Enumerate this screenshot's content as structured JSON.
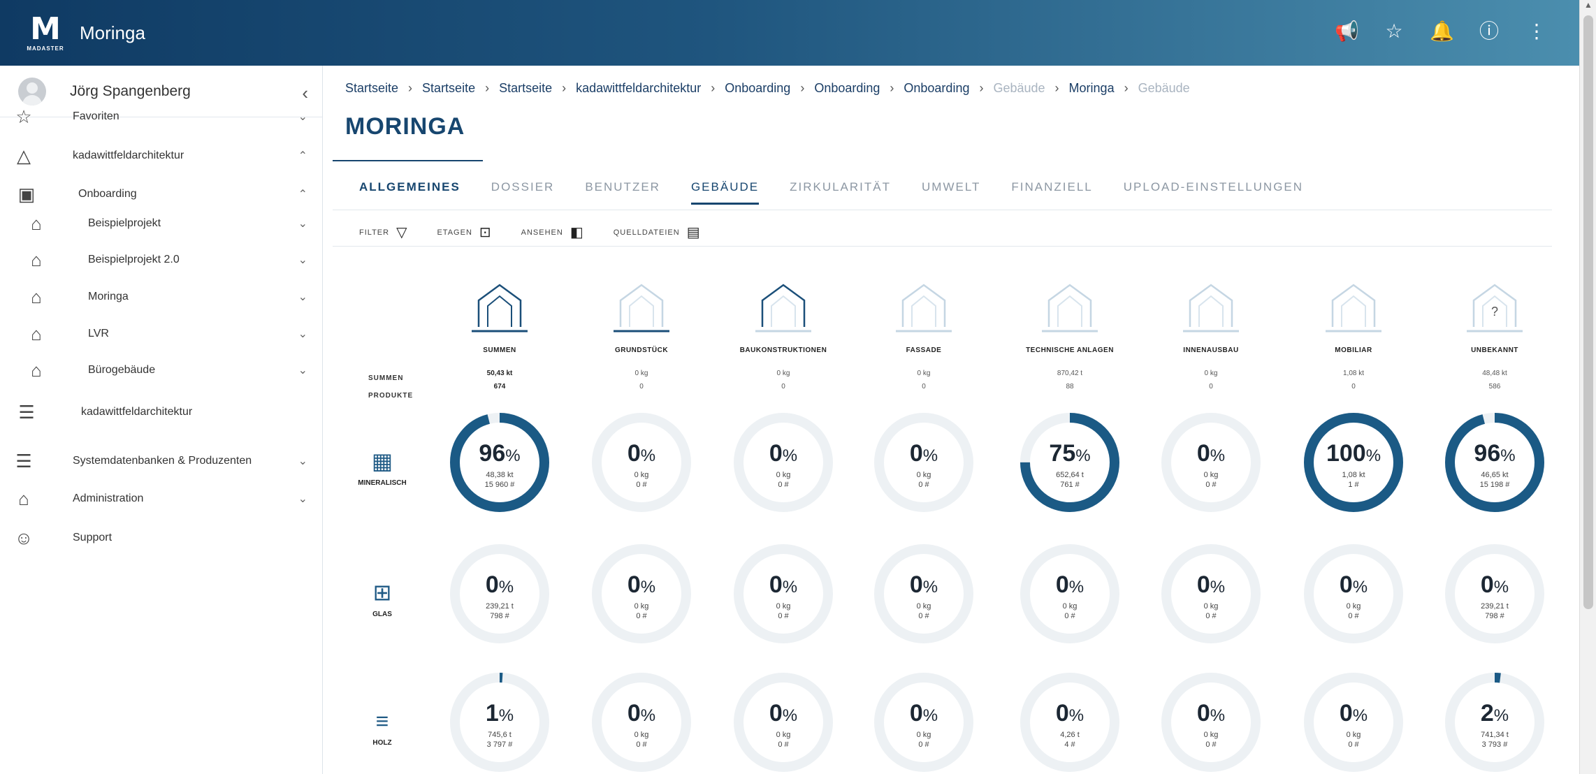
{
  "header": {
    "app_title": "Moringa",
    "logo_text": "MADASTER",
    "icons": [
      "megaphone-icon",
      "star-icon",
      "bell-icon",
      "info-icon",
      "more-icon"
    ]
  },
  "sidebar": {
    "user_name": "Jörg Spangenberg",
    "items": [
      {
        "label": "Favoriten",
        "icon": "star-outline-icon",
        "chev": "⌄"
      },
      {
        "label": "kadawittfeldarchitektur",
        "icon": "triangle-icon",
        "chev": "⌃"
      },
      {
        "label": "Onboarding",
        "icon": "folder-icon",
        "chev": "⌃"
      },
      {
        "label": "Beispielprojekt",
        "icon": "building-icon",
        "chev": "⌄"
      },
      {
        "label": "Beispielprojekt 2.0",
        "icon": "building-icon",
        "chev": "⌄"
      },
      {
        "label": "Moringa",
        "icon": "building-icon",
        "chev": "⌄"
      },
      {
        "label": "LVR",
        "icon": "building-icon",
        "chev": "⌄"
      },
      {
        "label": "Bürogebäude",
        "icon": "building-icon",
        "chev": "⌄"
      },
      {
        "label": "kadawittfeldarchitektur",
        "icon": "database-icon",
        "chev": ""
      },
      {
        "label": "Systemdatenbanken & Produzenten",
        "icon": "database-settings-icon",
        "chev": "⌄"
      },
      {
        "label": "Administration",
        "icon": "admin-house-icon",
        "chev": "⌄"
      },
      {
        "label": "Support",
        "icon": "support-icon",
        "chev": ""
      }
    ]
  },
  "breadcrumb": [
    {
      "label": "Startseite",
      "dim": false
    },
    {
      "label": "Startseite",
      "dim": false
    },
    {
      "label": "Startseite",
      "dim": false
    },
    {
      "label": "kadawittfeldarchitektur",
      "dim": false
    },
    {
      "label": "Onboarding",
      "dim": false
    },
    {
      "label": "Onboarding",
      "dim": false
    },
    {
      "label": "Onboarding",
      "dim": false
    },
    {
      "label": "Gebäude",
      "dim": true
    },
    {
      "label": "Moringa",
      "dim": false
    },
    {
      "label": "Gebäude",
      "dim": true
    }
  ],
  "page_title": "MORINGA",
  "tabs": [
    "ALLGEMEINES",
    "DOSSIER",
    "BENUTZER",
    "GEBÄUDE",
    "ZIRKULARITÄT",
    "UMWELT",
    "FINANZIELL",
    "UPLOAD-EINSTELLUNGEN"
  ],
  "active_tab": "GEBÄUDE",
  "toolbar": [
    {
      "label": "FILTER",
      "icon": "filter-icon"
    },
    {
      "label": "ETAGEN",
      "icon": "floors-icon"
    },
    {
      "label": "ANSEHEN",
      "icon": "view-icon"
    },
    {
      "label": "QUELLDATEIEN",
      "icon": "source-file-icon"
    }
  ],
  "row_labels": {
    "summen": "SUMMEN",
    "produkte": "PRODUKTE"
  },
  "categories": [
    {
      "name": "SUMMEN",
      "sum": "50,43 kt",
      "products": "674"
    },
    {
      "name": "GRUNDSTÜCK",
      "sum": "0 kg",
      "products": "0"
    },
    {
      "name": "BAUKONSTRUKTIONEN",
      "sum": "0 kg",
      "products": "0"
    },
    {
      "name": "FASSADE",
      "sum": "0 kg",
      "products": "0"
    },
    {
      "name": "TECHNISCHE ANLAGEN",
      "sum": "870,42 t",
      "products": "88"
    },
    {
      "name": "INNENAUSBAU",
      "sum": "0 kg",
      "products": "0"
    },
    {
      "name": "MOBILIAR",
      "sum": "1,08 kt",
      "products": "0"
    },
    {
      "name": "UNBEKANNT",
      "sum": "48,48 kt",
      "products": "586"
    }
  ],
  "materials": [
    {
      "name": "MINERALISCH",
      "icon": "mineral-icon",
      "cells": [
        {
          "pct": 96,
          "weight": "48,38 kt",
          "count": "15 960 #"
        },
        {
          "pct": 0,
          "weight": "0 kg",
          "count": "0 #"
        },
        {
          "pct": 0,
          "weight": "0 kg",
          "count": "0 #"
        },
        {
          "pct": 0,
          "weight": "0 kg",
          "count": "0 #"
        },
        {
          "pct": 75,
          "weight": "652,64 t",
          "count": "761 #"
        },
        {
          "pct": 0,
          "weight": "0 kg",
          "count": "0 #"
        },
        {
          "pct": 100,
          "weight": "1,08 kt",
          "count": "1 #"
        },
        {
          "pct": 96,
          "weight": "46,65 kt",
          "count": "15 198 #"
        }
      ]
    },
    {
      "name": "GLAS",
      "icon": "window-icon",
      "cells": [
        {
          "pct": 0,
          "weight": "239,21 t",
          "count": "798 #"
        },
        {
          "pct": 0,
          "weight": "0 kg",
          "count": "0 #"
        },
        {
          "pct": 0,
          "weight": "0 kg",
          "count": "0 #"
        },
        {
          "pct": 0,
          "weight": "0 kg",
          "count": "0 #"
        },
        {
          "pct": 0,
          "weight": "0 kg",
          "count": "0 #"
        },
        {
          "pct": 0,
          "weight": "0 kg",
          "count": "0 #"
        },
        {
          "pct": 0,
          "weight": "0 kg",
          "count": "0 #"
        },
        {
          "pct": 0,
          "weight": "239,21 t",
          "count": "798 #"
        }
      ]
    },
    {
      "name": "HOLZ",
      "icon": "wood-icon",
      "cells": [
        {
          "pct": 1,
          "weight": "745,6 t",
          "count": "3 797 #"
        },
        {
          "pct": 0,
          "weight": "0 kg",
          "count": "0 #"
        },
        {
          "pct": 0,
          "weight": "0 kg",
          "count": "0 #"
        },
        {
          "pct": 0,
          "weight": "0 kg",
          "count": "0 #"
        },
        {
          "pct": 0,
          "weight": "4,26 t",
          "count": "4 #"
        },
        {
          "pct": 0,
          "weight": "0 kg",
          "count": "0 #"
        },
        {
          "pct": 0,
          "weight": "0 kg",
          "count": "0 #"
        },
        {
          "pct": 2,
          "weight": "741,34 t",
          "count": "3 793 #"
        }
      ]
    }
  ],
  "colors": {
    "accent": "#17466f",
    "ring": "#1b5a85",
    "track": "#edf1f4"
  }
}
